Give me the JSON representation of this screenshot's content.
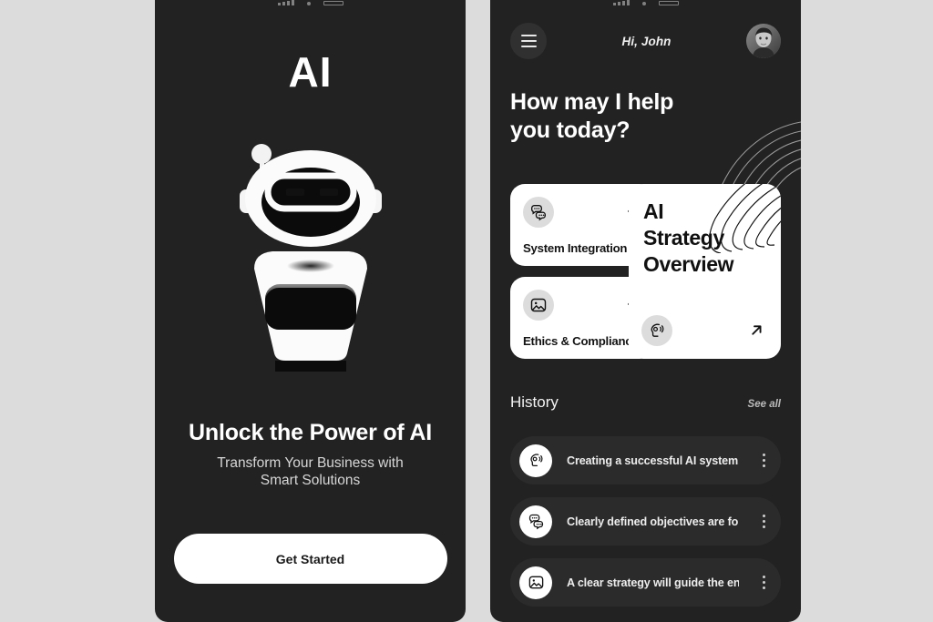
{
  "background_color": "#dcdcdc",
  "screens": {
    "onboarding": {
      "logo": "AI",
      "illustration": "robot-mascot",
      "title": "Unlock the Power of AI",
      "subtitle_line1": "Transform Your Business with",
      "subtitle_line2": "Smart Solutions",
      "cta_label": "Get Started",
      "surface_color": "#222222",
      "cta_color": "#ffffff"
    },
    "home": {
      "menu_icon": "hamburger-menu-icon",
      "greeting": "Hi, John",
      "avatar_icon": "user-avatar-photo",
      "headline_line1": "How may I help",
      "headline_line2": "you today?",
      "cards": [
        {
          "label": "System Integration",
          "icon": "chat-bubbles-icon",
          "arrow": "arrow-up-right-icon",
          "size": "small"
        },
        {
          "label": "Ethics & Compliance",
          "icon": "image-photo-icon",
          "arrow": "arrow-up-right-icon",
          "size": "small"
        }
      ],
      "feature_card": {
        "title_line1": "AI",
        "title_line2": "Strategy",
        "title_line3": "Overview",
        "icon": "speaking-head-icon",
        "arrow": "arrow-up-right-icon",
        "decoration": "contour-lines"
      },
      "history": {
        "title": "History",
        "see_all_label": "See all",
        "items": [
          {
            "text": "Creating a successful AI system...",
            "icon": "speaking-head-icon",
            "menu_icon": "kebab-menu-icon"
          },
          {
            "text": "Clearly defined objectives are  for...",
            "icon": "chat-bubbles-icon",
            "menu_icon": "kebab-menu-icon"
          },
          {
            "text": "A clear strategy will guide the entire...",
            "icon": "image-photo-icon",
            "menu_icon": "kebab-menu-icon"
          }
        ]
      }
    }
  }
}
